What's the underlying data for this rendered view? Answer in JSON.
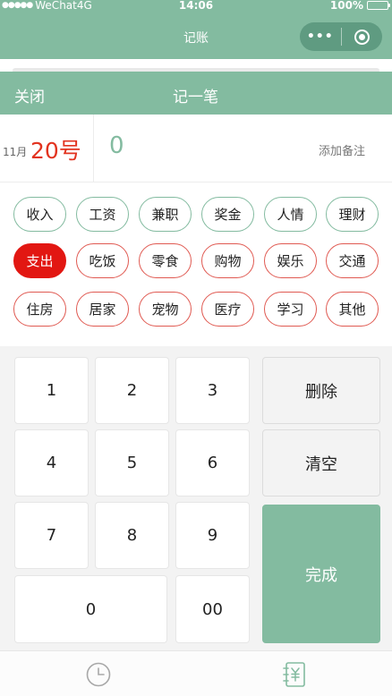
{
  "status_bar": {
    "carrier": "WeChat4G",
    "time": "14:06",
    "battery": "100%"
  },
  "nav": {
    "title": "记账"
  },
  "header": {
    "close_label": "关闭",
    "title": "记一笔"
  },
  "entry": {
    "month": "11月",
    "day": "20号",
    "amount": "0",
    "note_label": "添加备注"
  },
  "categories": {
    "income": [
      "收入",
      "工资",
      "兼职",
      "奖金",
      "人情",
      "理财"
    ],
    "expense_row1": [
      "支出",
      "吃饭",
      "零食",
      "购物",
      "娱乐",
      "交通"
    ],
    "expense_row2": [
      "住房",
      "居家",
      "宠物",
      "医疗",
      "学习",
      "其他"
    ]
  },
  "keypad": {
    "k1": "1",
    "k2": "2",
    "k3": "3",
    "k4": "4",
    "k5": "5",
    "k6": "6",
    "k7": "7",
    "k8": "8",
    "k9": "9",
    "k0": "0",
    "k00": "00",
    "delete": "删除",
    "clear": "清空",
    "done": "完成"
  },
  "tabbar": {
    "left_icon": "clock-icon",
    "right_icon": "ledger-icon"
  },
  "colors": {
    "accent": "#83bba0",
    "expense_red": "#e21712",
    "amount_red": "#e2331f"
  }
}
